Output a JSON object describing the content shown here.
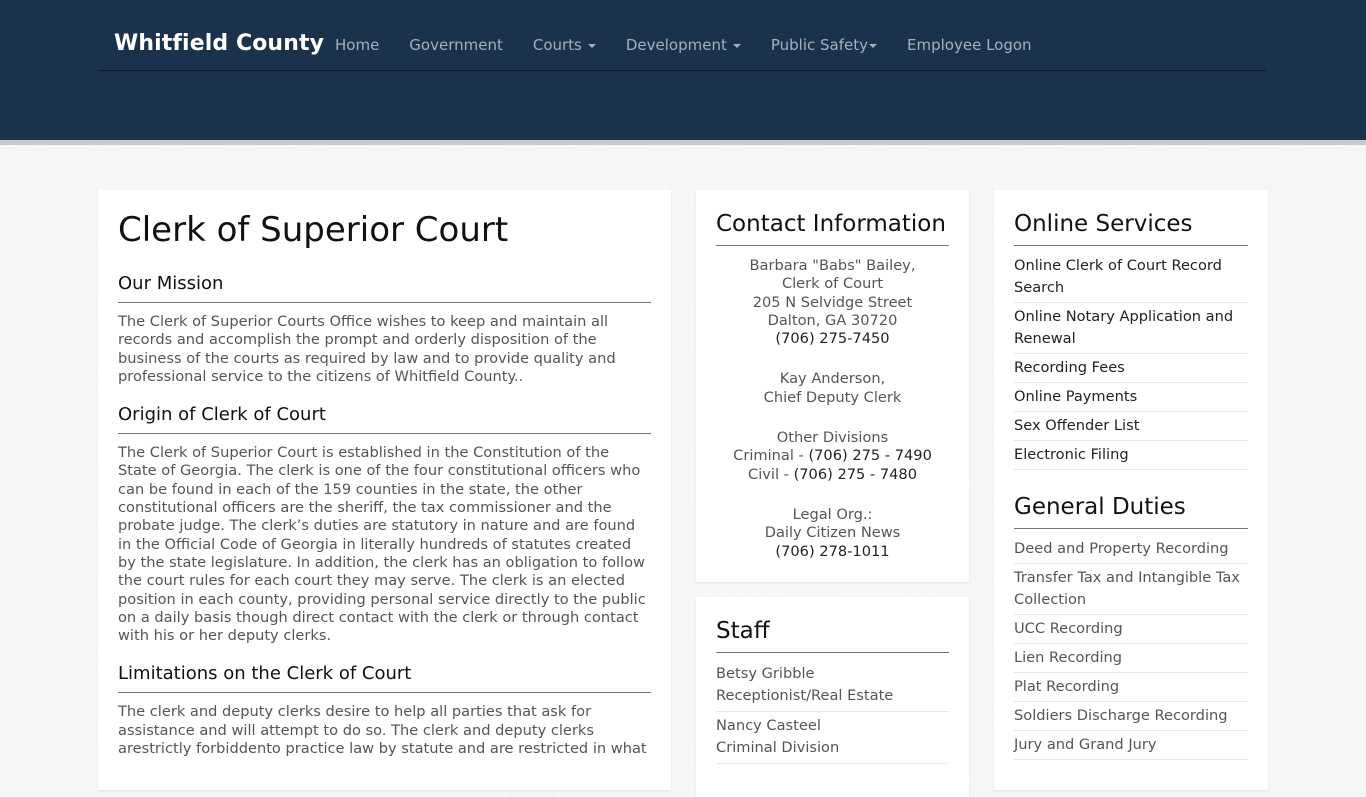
{
  "header": {
    "brand": "Whitfield County",
    "nav": [
      {
        "label": "Home",
        "dropdown": false
      },
      {
        "label": "Government",
        "dropdown": false
      },
      {
        "label": "Courts",
        "dropdown": true
      },
      {
        "label": "Development",
        "dropdown": true
      },
      {
        "label": "Public Safety",
        "dropdown": true
      },
      {
        "label": "Employee Logon",
        "dropdown": false
      }
    ]
  },
  "main": {
    "title": "Clerk of Superior Court",
    "sections": [
      {
        "heading": "Our Mission",
        "text": "The Clerk of Superior Courts Office wishes to keep and maintain all records and accomplish the prompt and orderly disposition of the business of the courts as required by law and to provide quality and professional service to the citizens of Whitfield County.."
      },
      {
        "heading": "Origin of Clerk of Court",
        "text": "The Clerk of Superior Court is established in the Constitution of the State of Georgia.  The clerk is one of the four constitutional officers who can be found in each of the 159 counties in the state, the other constitutional officers are the sheriff, the tax commissioner and the probate judge. The clerk’s duties are statutory in nature and are found in the Official Code of Georgia in literally hundreds of statutes created by the state legislature. In addition, the clerk has an obligation to follow the court rules for each court they may serve. The clerk is an elected position in each county, providing personal service directly to the public on a daily basis though direct contact with the clerk or through contact with his or her deputy clerks."
      },
      {
        "heading": "Limitations on the Clerk of Court",
        "text": "The clerk and deputy clerks desire to help all parties that ask for assistance and will attempt to do so.   The clerk and deputy clerks arestrictly forbiddento practice law by statute and are restricted in what"
      }
    ]
  },
  "contact": {
    "heading": "Contact Information",
    "clerk_name": "Barbara \"Babs\" Bailey,",
    "clerk_title": "Clerk of Court",
    "street": "205 N Selvidge Street",
    "city": "Dalton, GA 30720",
    "phone": "(706) 275-7450",
    "deputy_name": "Kay Anderson,",
    "deputy_title": "Chief Deputy Clerk",
    "divisions_label": "Other Divisions",
    "criminal_label": "Criminal - ",
    "criminal_phone": "(706) 275 - 7490",
    "civil_label": "Civil - ",
    "civil_phone": "(706) 275 - 7480",
    "legal_label": "Legal Org.:",
    "legal_name": "Daily Citizen News",
    "legal_phone": "(706) 278-1011"
  },
  "staff": {
    "heading": "Staff",
    "members": [
      {
        "name": "Betsy Gribble",
        "role": "Receptionist/Real Estate"
      },
      {
        "name": "Nancy Casteel",
        "role": "Criminal Division"
      }
    ]
  },
  "online_services": {
    "heading": "Online Services",
    "items": [
      "Online Clerk of Court Record Search",
      "Online Notary Application and Renewal",
      "Recording Fees",
      "Online Payments",
      "Sex Offender List",
      "Electronic Filing"
    ]
  },
  "general_duties": {
    "heading": "General Duties",
    "items": [
      "Deed and Property Recording",
      "Transfer Tax and Intangible Tax Collection",
      "UCC Recording",
      "Lien Recording",
      "Plat Recording",
      "Soldiers Discharge Recording",
      "Jury and Grand Jury"
    ]
  }
}
